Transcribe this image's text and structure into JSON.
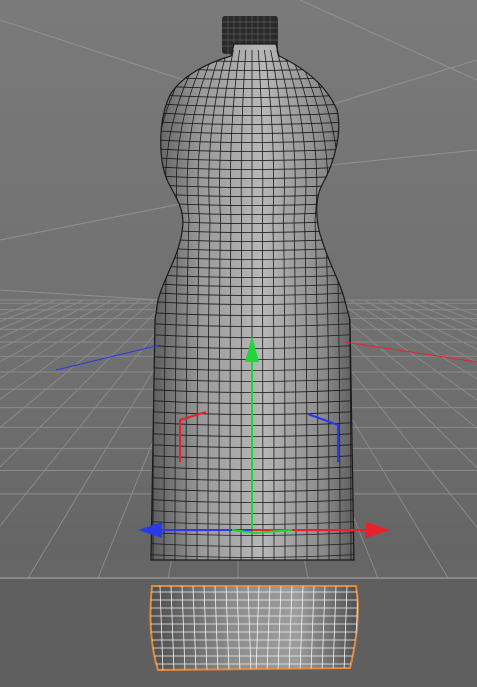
{
  "viewport": {
    "background": "#6f6f6f",
    "grid_color": "#8a8a8a",
    "horizon_color": "#9a9a9a"
  },
  "model": {
    "shape": "plastic-bottle",
    "wire_color": "#1a1a1a",
    "surface_color": "#a6a6a6",
    "selected_outline_color": "#e38a3c",
    "selected_wire_color": "#f2f2f2"
  },
  "gizmo": {
    "type": "move-tool",
    "x_axis_color": "#e8222a",
    "y_axis_color": "#22d33a",
    "z_axis_color": "#2a3ae8"
  }
}
